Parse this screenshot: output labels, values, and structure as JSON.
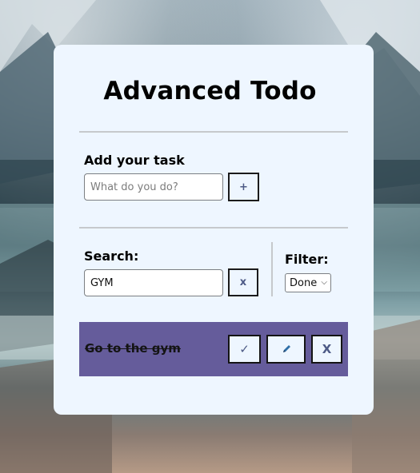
{
  "app": {
    "title": "Advanced Todo"
  },
  "add": {
    "label": "Add your task",
    "placeholder": "What do you do?",
    "button_icon": "+"
  },
  "search": {
    "label": "Search:",
    "value": "GYM",
    "clear_icon": "x"
  },
  "filter": {
    "label": "Filter:",
    "selected": "Done",
    "chevron": "⌵"
  },
  "tasks": [
    {
      "text": "Go to the gym",
      "done": true,
      "check_icon": "✓",
      "edit_icon": "pencil-icon",
      "delete_icon": "X"
    }
  ],
  "colors": {
    "card_bg": "#eef6ff",
    "task_bg": "#655c9b",
    "button_icon": "#4d5a86"
  }
}
